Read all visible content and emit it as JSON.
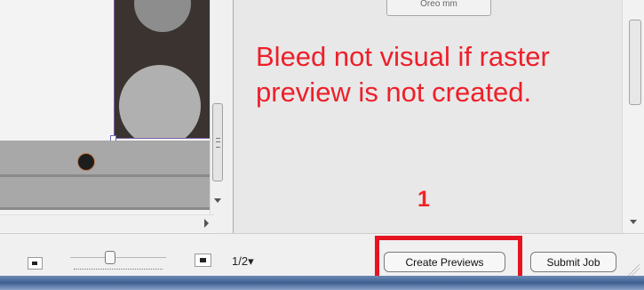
{
  "preview_panel": {
    "note": "Bleed not visual if raster preview is not created.",
    "top_control_text": "Oreo mm",
    "marker": "1"
  },
  "toolbar": {
    "page_indicator": "1/2▾",
    "create_previews_label": "Create Previews",
    "submit_job_label": "Submit Job"
  },
  "colors": {
    "annotation": "#e51420",
    "artwork": "#3a3330"
  },
  "icons": {
    "small_thumbnail": "small-thumbnail-icon",
    "large_thumbnail": "large-thumbnail-icon",
    "dropdown": "dropdown-icon"
  }
}
